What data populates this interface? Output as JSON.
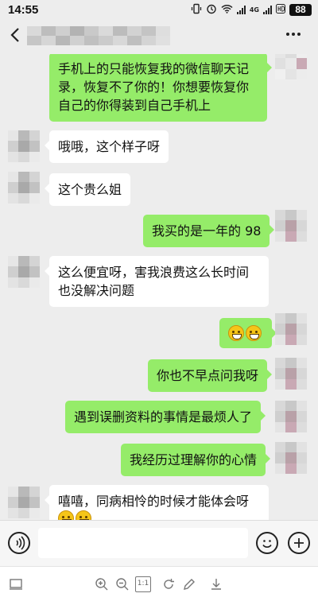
{
  "status_bar": {
    "time": "14:55",
    "network_label": "4G",
    "battery_level": "88"
  },
  "icons": [
    "vibrate-icon",
    "alarm-icon",
    "wifi-icon",
    "signal-icon",
    "hd-icon",
    "battery-icon",
    "back-icon",
    "more-icon",
    "voice-icon",
    "emoji-icon",
    "plus-icon"
  ],
  "chat": {
    "messages": [
      {
        "side": "out",
        "text": "手机上的只能恢复我的微信聊天记录，恢复不了你的！你想要恢复你自己的你得装到自己手机上"
      },
      {
        "side": "in",
        "text": "哦哦，这个样子呀"
      },
      {
        "side": "in",
        "text": "这个贵么姐"
      },
      {
        "side": "out",
        "text": "我买的是一年的 98"
      },
      {
        "side": "in",
        "text": "这么便宜呀，害我浪费这么长时间也没解决问题"
      },
      {
        "side": "out",
        "text": ""
      },
      {
        "side": "out",
        "text": "你也不早点问我呀"
      },
      {
        "side": "out",
        "text": "遇到误删资料的事情是最烦人了"
      },
      {
        "side": "out",
        "text": "我经历过理解你的心情"
      },
      {
        "side": "in",
        "text": "嘻嘻，同病相怜的时候才能体会呀"
      }
    ]
  },
  "colors": {
    "background": "#ededed",
    "bubble_out": "#95ec69",
    "bubble_in": "#ffffff"
  },
  "input": {
    "value": ""
  },
  "viewer_toolbar": {
    "zoom_reset_label": "1:1"
  }
}
